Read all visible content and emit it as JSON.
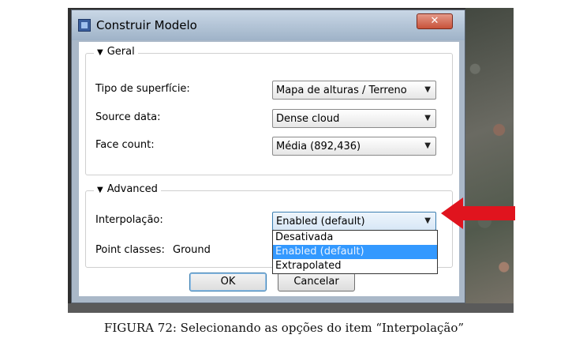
{
  "window": {
    "title": "Construir Modelo",
    "close_glyph": "✕"
  },
  "general": {
    "legend": "Geral",
    "surface_type": {
      "label": "Tipo de superfície:",
      "value": "Mapa de alturas / Terreno"
    },
    "source_data": {
      "label": "Source data:",
      "value": "Dense cloud"
    },
    "face_count": {
      "label": "Face count:",
      "value": "Média (892,436)"
    }
  },
  "advanced": {
    "legend": "Advanced",
    "interpolation": {
      "label": "Interpolação:",
      "value": "Enabled (default)",
      "options": [
        "Desativada",
        "Enabled (default)",
        "Extrapolated"
      ],
      "highlighted": "Enabled (default)"
    },
    "point_classes": {
      "label": "Point classes:",
      "value": "Ground"
    }
  },
  "buttons": {
    "ok": "OK",
    "cancel": "Cancelar"
  },
  "annotation": {
    "arrow_color": "#e0141e"
  },
  "caption": "FIGURA 72: Selecionando as opções do item “Interpolação”",
  "icons": [
    "window-app-icon",
    "close-icon",
    "collapse-triangle-icon",
    "dropdown-arrow-icon",
    "red-pointer-arrow-icon"
  ]
}
